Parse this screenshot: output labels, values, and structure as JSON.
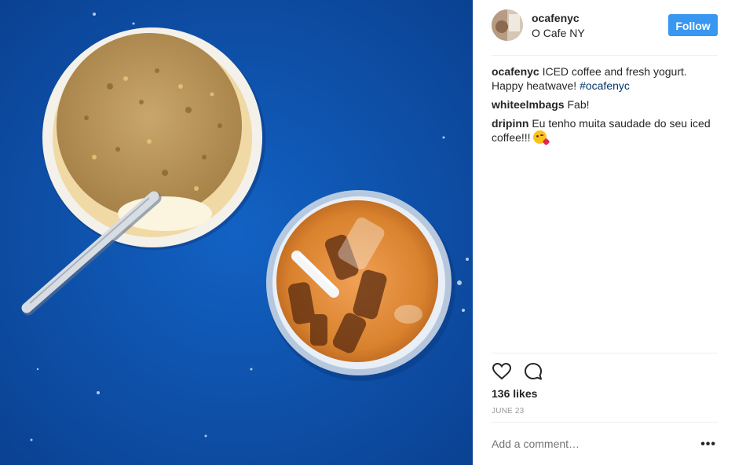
{
  "post": {
    "username": "ocafenyc",
    "location": "O Cafe NY",
    "follow_label": "Follow",
    "comments": [
      {
        "author": "ocafenyc",
        "text": "ICED coffee and fresh yogurt. Happy heatwave! ",
        "hashtag": "#ocafenyc"
      },
      {
        "author": "whiteelmbags",
        "text": "Fab!"
      },
      {
        "author": "dripinn",
        "text": "Eu tenho muita saudade do seu iced coffee!!!"
      }
    ],
    "likes": "136 likes",
    "date": "JUNE 23",
    "add_comment_placeholder": "Add a comment…",
    "more_label": "•••"
  },
  "icons": {
    "like": "heart-outline-icon",
    "comment": "speech-bubble-icon",
    "more": "ellipsis-icon",
    "emoji": "face-blowing-kiss-emoji"
  },
  "colors": {
    "follow_button": "#3897f0",
    "hashtag": "#003569",
    "photo_background": "#0d4fa6"
  }
}
